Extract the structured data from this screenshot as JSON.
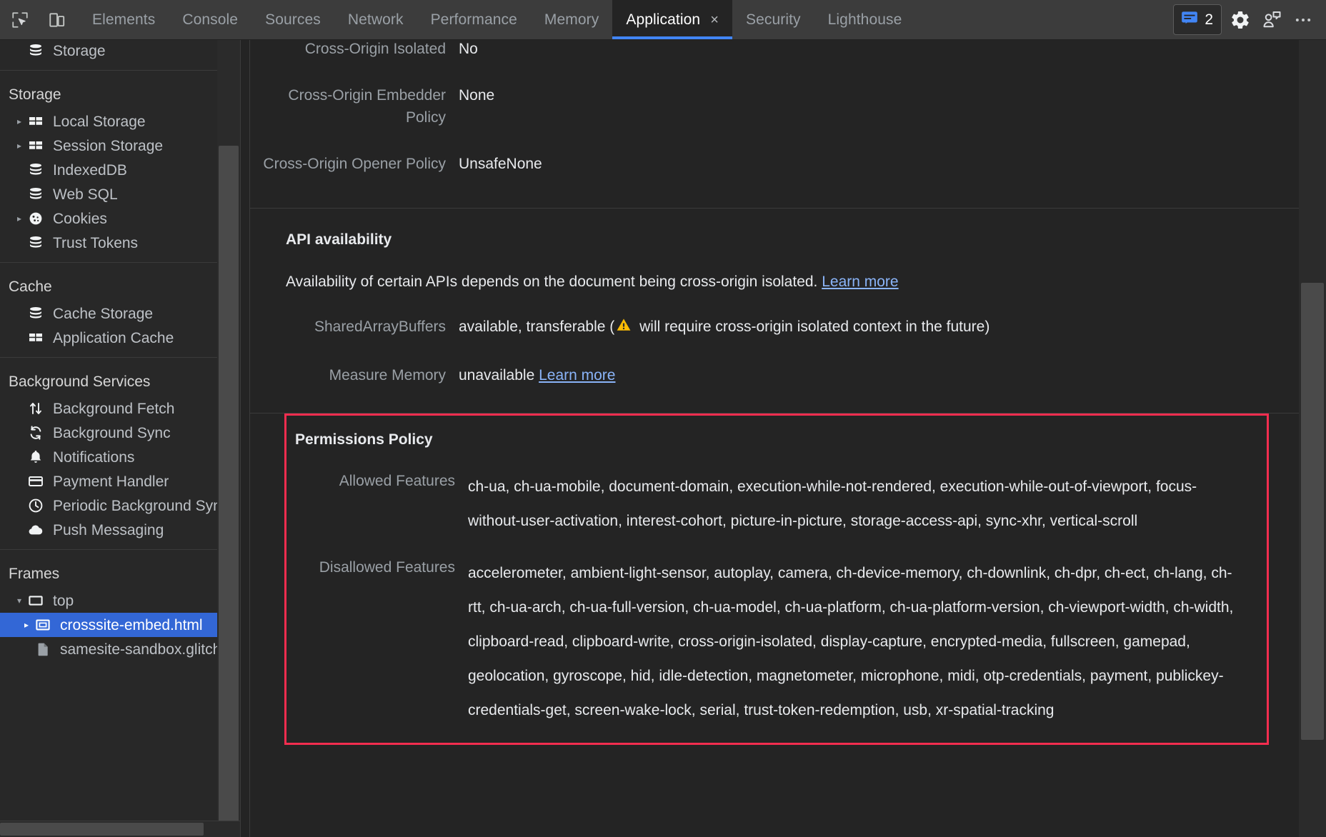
{
  "toolbar": {
    "inspect_icon": "inspect-cursor-icon",
    "device_icon": "device-toolbar-icon",
    "tabs": [
      {
        "label": "Elements",
        "active": false,
        "closable": false
      },
      {
        "label": "Console",
        "active": false,
        "closable": false
      },
      {
        "label": "Sources",
        "active": false,
        "closable": false
      },
      {
        "label": "Network",
        "active": false,
        "closable": false
      },
      {
        "label": "Performance",
        "active": false,
        "closable": false
      },
      {
        "label": "Memory",
        "active": false,
        "closable": false
      },
      {
        "label": "Application",
        "active": true,
        "closable": true
      },
      {
        "label": "Security",
        "active": false,
        "closable": false
      },
      {
        "label": "Lighthouse",
        "active": false,
        "closable": false
      }
    ],
    "close_glyph": "×",
    "issues": {
      "icon": "issues-message-icon",
      "count": "2",
      "accent": "#4285f4"
    },
    "settings_icon": "gear-icon",
    "feedback_icon": "feedback-person-icon",
    "more_icon": "more-options-icon",
    "more_glyph": "⋯"
  },
  "sidebar": {
    "clipped_top_item": {
      "label": "Storage",
      "icon": "database-icon"
    },
    "groups": [
      {
        "header": "Storage",
        "items": [
          {
            "label": "Local Storage",
            "icon": "table-icon",
            "expandable": true,
            "expanded": false,
            "selected": false
          },
          {
            "label": "Session Storage",
            "icon": "table-icon",
            "expandable": true,
            "expanded": false,
            "selected": false
          },
          {
            "label": "IndexedDB",
            "icon": "database-icon",
            "expandable": false,
            "expanded": false,
            "selected": false
          },
          {
            "label": "Web SQL",
            "icon": "database-icon",
            "expandable": false,
            "expanded": false,
            "selected": false
          },
          {
            "label": "Cookies",
            "icon": "cookie-icon",
            "expandable": true,
            "expanded": false,
            "selected": false
          },
          {
            "label": "Trust Tokens",
            "icon": "database-icon",
            "expandable": false,
            "expanded": false,
            "selected": false
          }
        ]
      },
      {
        "header": "Cache",
        "items": [
          {
            "label": "Cache Storage",
            "icon": "database-icon",
            "expandable": false,
            "expanded": false,
            "selected": false
          },
          {
            "label": "Application Cache",
            "icon": "table-icon",
            "expandable": false,
            "expanded": false,
            "selected": false
          }
        ]
      },
      {
        "header": "Background Services",
        "items": [
          {
            "label": "Background Fetch",
            "icon": "arrows-up-down-icon",
            "expandable": false,
            "expanded": false,
            "selected": false
          },
          {
            "label": "Background Sync",
            "icon": "sync-icon",
            "expandable": false,
            "expanded": false,
            "selected": false
          },
          {
            "label": "Notifications",
            "icon": "bell-icon",
            "expandable": false,
            "expanded": false,
            "selected": false
          },
          {
            "label": "Payment Handler",
            "icon": "credit-card-icon",
            "expandable": false,
            "expanded": false,
            "selected": false
          },
          {
            "label": "Periodic Background Sync",
            "icon": "clock-icon",
            "expandable": false,
            "expanded": false,
            "selected": false
          },
          {
            "label": "Push Messaging",
            "icon": "cloud-icon",
            "expandable": false,
            "expanded": false,
            "selected": false
          }
        ]
      },
      {
        "header": "Frames",
        "items": [
          {
            "label": "top",
            "icon": "frame-icon",
            "expandable": true,
            "expanded": true,
            "selected": false
          },
          {
            "label": "crosssite-embed.html",
            "icon": "iframe-icon",
            "expandable": true,
            "expanded": false,
            "selected": true,
            "sub": true
          },
          {
            "label": "samesite-sandbox.glitch",
            "icon": "document-icon",
            "expandable": false,
            "expanded": false,
            "selected": false,
            "sub": true
          }
        ]
      }
    ],
    "selected_color": "#3367d6"
  },
  "main": {
    "security_isolation": {
      "rows": [
        {
          "key": "Cross-Origin Isolated",
          "value": "No"
        },
        {
          "key": "Cross-Origin Embedder Policy",
          "value": "None"
        },
        {
          "key": "Cross-Origin Opener Policy",
          "value": "UnsafeNone"
        }
      ]
    },
    "api_availability": {
      "title": "API availability",
      "note_text": "Availability of certain APIs depends on the document being cross-origin isolated. ",
      "note_link": "Learn more",
      "rows": [
        {
          "key": "SharedArrayBuffers",
          "value_pre": "available, transferable  (",
          "warning_icon": "warning-triangle-icon",
          "value_post": " will require cross-origin isolated context in the future)",
          "link": ""
        },
        {
          "key": "Measure Memory",
          "value_pre": "unavailable ",
          "warning_icon": "",
          "value_post": "",
          "link": "Learn more"
        }
      ]
    },
    "permissions_policy": {
      "title": "Permissions Policy",
      "highlight_color": "#f32d4f",
      "rows": [
        {
          "key": "Allowed Features",
          "value": "ch-ua, ch-ua-mobile, document-domain, execution-while-not-rendered, execution-while-out-of-viewport, focus-without-user-activation, interest-cohort, picture-in-picture, storage-access-api, sync-xhr, vertical-scroll"
        },
        {
          "key": "Disallowed Features",
          "value": "accelerometer, ambient-light-sensor, autoplay, camera, ch-device-memory, ch-downlink, ch-dpr, ch-ect, ch-lang, ch-rtt, ch-ua-arch, ch-ua-full-version, ch-ua-model, ch-ua-platform, ch-ua-platform-version, ch-viewport-width, ch-width, clipboard-read, clipboard-write, cross-origin-isolated, display-capture, encrypted-media, fullscreen, gamepad, geolocation, gyroscope, hid, idle-detection, magnetometer, microphone, midi, otp-credentials, payment, publickey-credentials-get, screen-wake-lock, serial, trust-token-redemption, usb, xr-spatial-tracking"
        }
      ]
    }
  }
}
